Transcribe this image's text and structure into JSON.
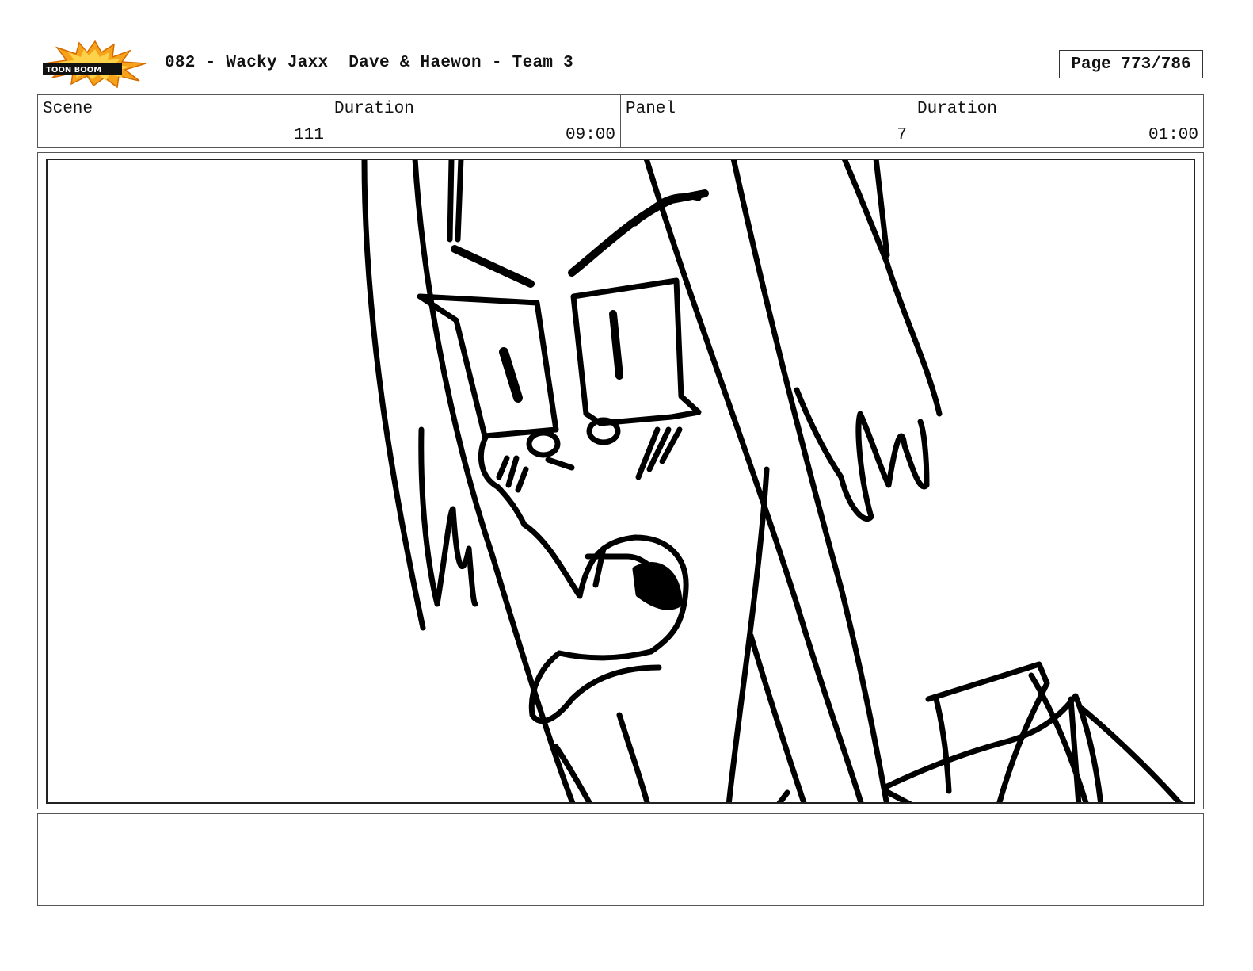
{
  "header": {
    "logo_text": "TOON BOOM",
    "title": "082 - Wacky Jaxx  Dave & Haewon - Team 3",
    "page_label": "Page 773/786"
  },
  "info": {
    "scene_label": "Scene",
    "scene_value": "111",
    "duration_label": "Duration",
    "duration_value": "09:00",
    "panel_label": "Panel",
    "panel_value": "7",
    "panel_duration_label": "Duration",
    "panel_duration_value": "01:00"
  },
  "panel": {
    "image": "storyboard-sketch-angry-character-closeup"
  },
  "notes": {
    "text": ""
  }
}
